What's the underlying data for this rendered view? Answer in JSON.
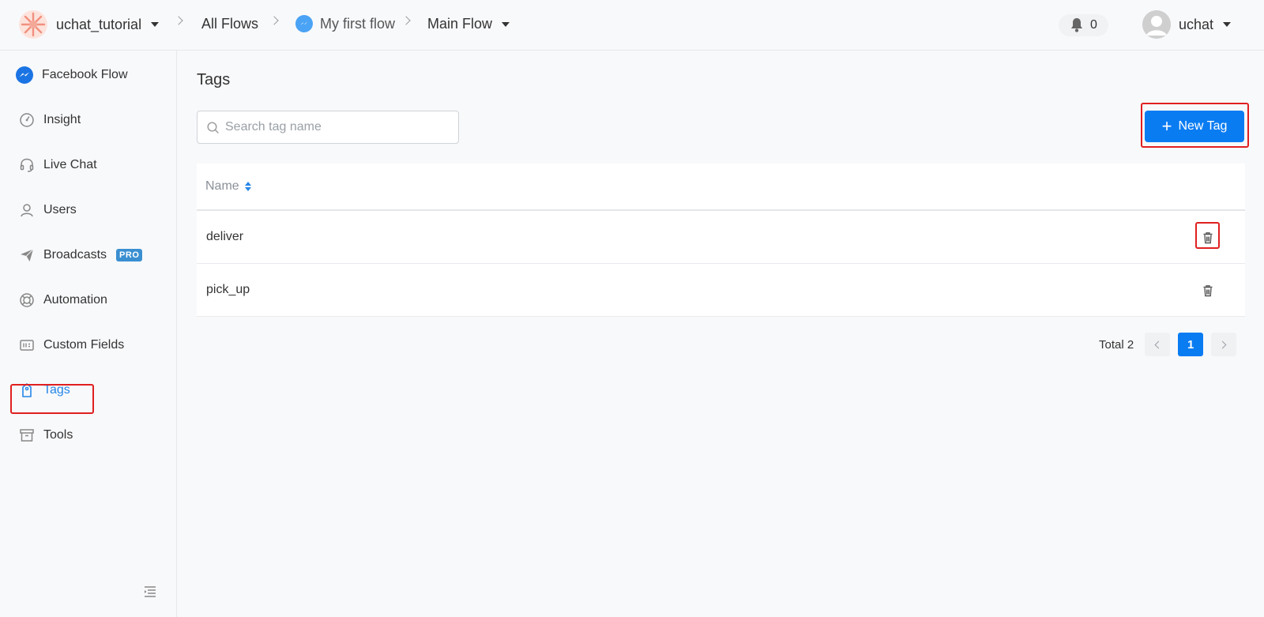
{
  "header": {
    "workspace": "uchat_tutorial",
    "breadcrumb": {
      "all_flows": "All Flows",
      "flow": "My first flow",
      "subflow": "Main Flow"
    },
    "notifications_count": "0",
    "user_name": "uchat"
  },
  "sidebar": {
    "items": [
      {
        "label": "Facebook Flow",
        "icon": "messenger-icon"
      },
      {
        "label": "Insight",
        "icon": "gauge-icon"
      },
      {
        "label": "Live Chat",
        "icon": "headset-icon"
      },
      {
        "label": "Users",
        "icon": "user-icon"
      },
      {
        "label": "Broadcasts",
        "icon": "paper-plane-icon",
        "badge": "PRO"
      },
      {
        "label": "Automation",
        "icon": "lifebuoy-icon"
      },
      {
        "label": "Custom Fields",
        "icon": "fields-icon"
      },
      {
        "label": "Tags",
        "icon": "tag-icon",
        "active": true
      },
      {
        "label": "Tools",
        "icon": "archive-box-icon"
      }
    ]
  },
  "main": {
    "title": "Tags",
    "search_placeholder": "Search tag name",
    "new_tag_label": "New Tag",
    "table": {
      "columns": [
        "Name"
      ],
      "rows": [
        {
          "name": "deliver"
        },
        {
          "name": "pick_up"
        }
      ]
    },
    "pagination": {
      "total_label": "Total 2",
      "current_page": "1"
    }
  },
  "colors": {
    "accent": "#0a7cf2",
    "active_link": "#2486e8",
    "highlight": "#e02020",
    "pro_badge": "#3a8fd1"
  }
}
